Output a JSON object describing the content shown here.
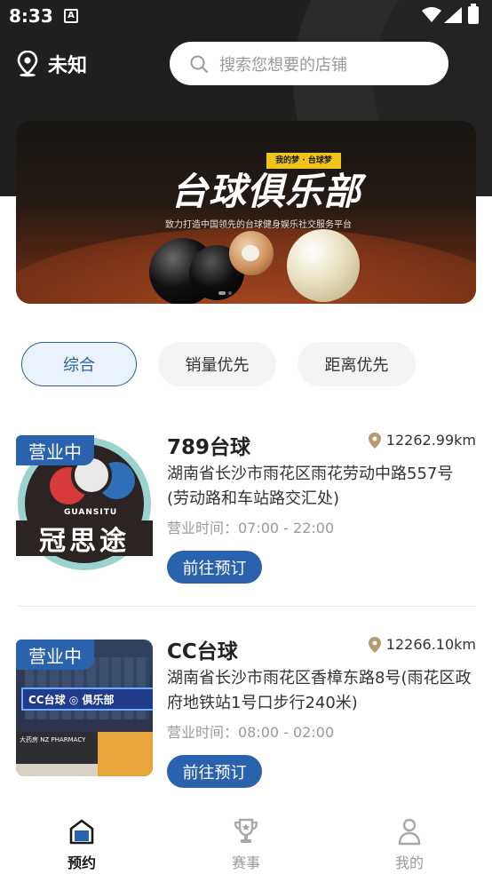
{
  "status_bar": {
    "time": "8:33",
    "notif_glyph": "A"
  },
  "header": {
    "location_label": "未知",
    "search_placeholder": "搜索您想要的店铺"
  },
  "banner": {
    "tag": "我的梦 · 台球梦",
    "title": "台球俱乐部",
    "subtitle": "致力打造中国领先的台球健身娱乐社交服务平台"
  },
  "filters": [
    "综合",
    "销量优先",
    "距离优先"
  ],
  "stores": [
    {
      "badge": "营业中",
      "name": "789台球",
      "distance": "12262.99km",
      "address": "湖南省长沙市雨花区雨花劳动中路557号(劳动路和车站路交汇处)",
      "hours": "营业时间：07:00 - 22:00",
      "book_label": "前往预订",
      "logo_text": "冠思途",
      "logo_brand": "GUANSITU"
    },
    {
      "badge": "营业中",
      "name": "CC台球",
      "distance": "12266.10km",
      "address": "湖南省长沙市雨花区香樟东路8号(雨花区政府地铁站1号口步行240米)",
      "hours": "营业时间：08:00 - 02:00",
      "book_label": "前往预订",
      "sign_text": "CC台球 ◎ 俱乐部",
      "shop_text": "大药房  NZ PHARMACY"
    }
  ],
  "tabbar": [
    {
      "label": "预约",
      "icon": "home-icon",
      "active": true
    },
    {
      "label": "赛事",
      "icon": "trophy-icon",
      "active": false
    },
    {
      "label": "我的",
      "icon": "user-icon",
      "active": false
    }
  ],
  "colors": {
    "primary": "#2a62ad",
    "hero_bg": "#1f1f1f",
    "chip_active": "#2a5f9e"
  }
}
